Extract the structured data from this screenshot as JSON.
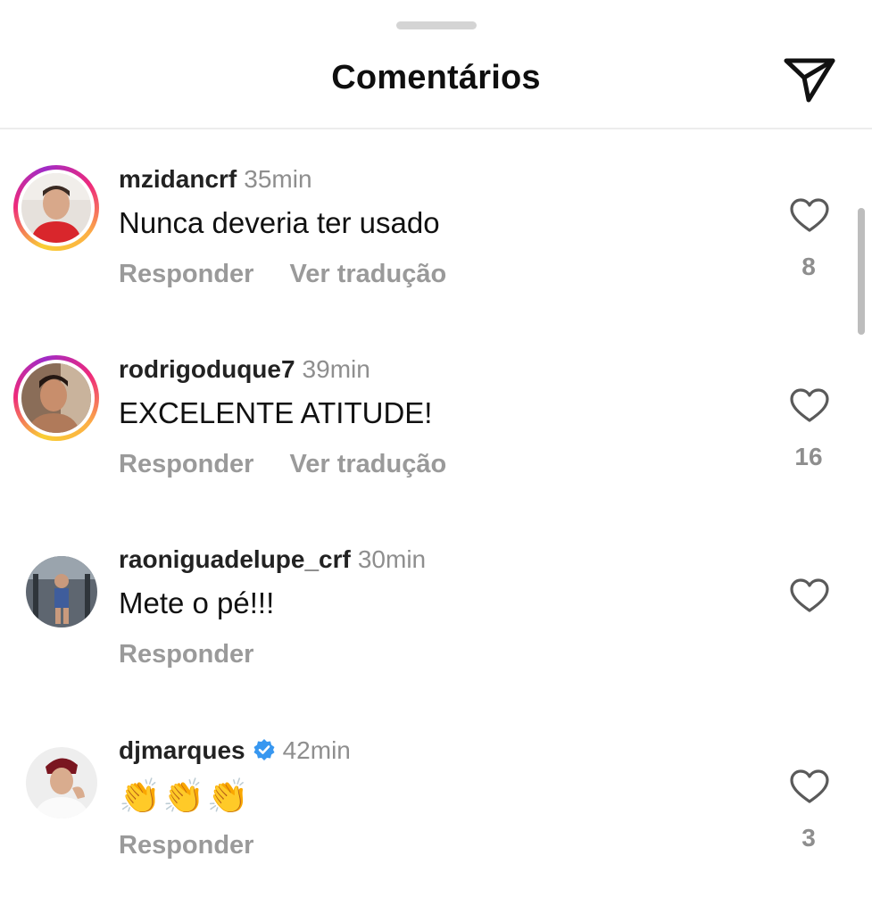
{
  "header": {
    "title": "Comentários",
    "share_icon": "paper-plane-icon"
  },
  "comments": [
    {
      "username": "mzidancrf",
      "time": "35min",
      "text": "Nunca deveria ter usado",
      "reply_label": "Responder",
      "translate_label": "Ver tradução",
      "likes": "8",
      "has_story": true,
      "verified": false
    },
    {
      "username": "rodrigoduque7",
      "time": "39min",
      "text": "EXCELENTE ATITUDE!",
      "reply_label": "Responder",
      "translate_label": "Ver tradução",
      "likes": "16",
      "has_story": true,
      "verified": false
    },
    {
      "username": "raoniguadelupe_crf",
      "time": "30min",
      "text": "Mete o pé!!!",
      "reply_label": "Responder",
      "likes": "",
      "has_story": false,
      "verified": false
    },
    {
      "username": "djmarques",
      "time": "42min",
      "text": "👏👏👏",
      "reply_label": "Responder",
      "likes": "3",
      "has_story": false,
      "verified": true
    }
  ],
  "colors": {
    "verified": "#3797f0",
    "secondary_text": "#8e8e8e",
    "action_text": "#9a9a9a"
  }
}
